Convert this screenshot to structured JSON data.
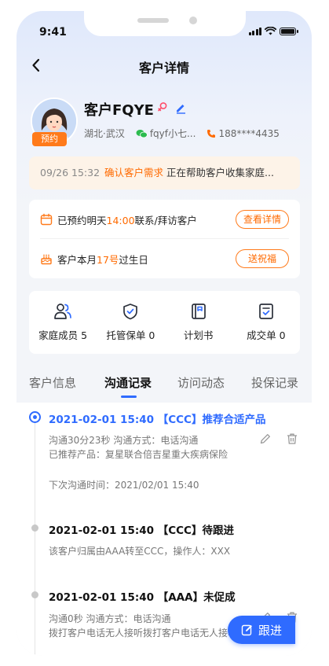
{
  "status_bar": {
    "time": "9:41"
  },
  "nav": {
    "title": "客户详情"
  },
  "customer": {
    "name": "客户FQYE",
    "badge": "预约",
    "location": "湖北·武汉",
    "wechat": "fqyf小七...",
    "phone": "188****4435"
  },
  "notice": {
    "time": "09/26 15:32",
    "action": "确认客户需求",
    "detail": "正在帮助客户收集家庭..."
  },
  "reminders": [
    {
      "before": "已预约明天",
      "highlight": "14:00",
      "after": "联系/拜访客户",
      "button": "查看详情"
    },
    {
      "before": "客户本月",
      "highlight": "17号",
      "after": "过生日",
      "button": "送祝福"
    }
  ],
  "quick_actions": [
    {
      "label": "家庭成员 5",
      "icon": "family-icon"
    },
    {
      "label": "托管保单 0",
      "icon": "shield-icon"
    },
    {
      "label": "计划书",
      "icon": "book-icon"
    },
    {
      "label": "成交单 0",
      "icon": "order-icon"
    }
  ],
  "tabs": [
    {
      "label": "客户信息",
      "active": false
    },
    {
      "label": "沟通记录",
      "active": true
    },
    {
      "label": "访问动态",
      "active": false
    },
    {
      "label": "投保记录",
      "active": false
    }
  ],
  "timeline": [
    {
      "title": "2021-02-01 15:40 【CCC】推荐合适产品",
      "line1": "沟通30分23秒    沟通方式：电话沟通",
      "line2": "已推荐产品：复星联合倍吉星重大疾病保险",
      "line3": "下次沟通时间：2021/02/01 15:40"
    },
    {
      "title": "2021-02-01 15:40 【CCC】待跟进",
      "line1": "该客户归属由AAA转至CCC，操作人：XXX"
    },
    {
      "title": "2021-02-01 15:40 【AAA】未促成",
      "line1": "沟通0秒    沟通方式：电话沟通",
      "line2": "拨打客户电话无人接听拨打客户电话无人接听"
    }
  ],
  "follow_button": {
    "label": "跟进"
  },
  "colors": {
    "primary": "#2f6bff",
    "accent": "#ff6a00",
    "badge": "#ff7a1a",
    "notice_bg": "#fdf3e8"
  }
}
